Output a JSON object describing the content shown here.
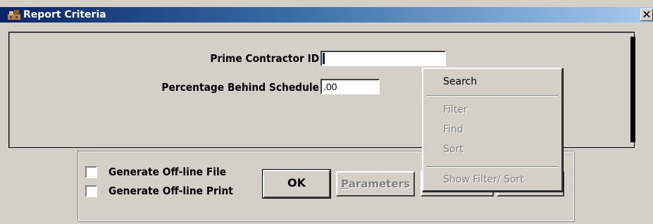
{
  "window": {
    "title": "Report Criteria",
    "close_glyph": "✕"
  },
  "criteria": {
    "prime_contractor_label": "Prime Contractor ID :",
    "prime_contractor_value": "",
    "percentage_label": "Percentage Behind Schedule :",
    "percentage_value": ".00"
  },
  "options": {
    "offline_file_label": "Generate Off-line File",
    "offline_file_checked": false,
    "offline_print_label": "Generate Off-line Print",
    "offline_print_checked": false
  },
  "buttons": {
    "ok_label": "OK",
    "parameters_underlined": "P",
    "parameters_rest": "arameters"
  },
  "context_menu": {
    "items": [
      {
        "label": "Search",
        "enabled": true
      },
      {
        "label": "Filter",
        "enabled": false
      },
      {
        "label": "Find",
        "enabled": false
      },
      {
        "label": "Sort",
        "enabled": false
      },
      {
        "label": "Show Filter/ Sort",
        "enabled": false
      }
    ]
  },
  "icons": {
    "title_icon": "report-app-icon",
    "close_icon": "close-icon"
  },
  "colors": {
    "title_gradient_start": "#0a246a",
    "title_gradient_end": "#a6caf0",
    "dialog_background": "#d4d0c8",
    "disabled_text": "#808080"
  }
}
